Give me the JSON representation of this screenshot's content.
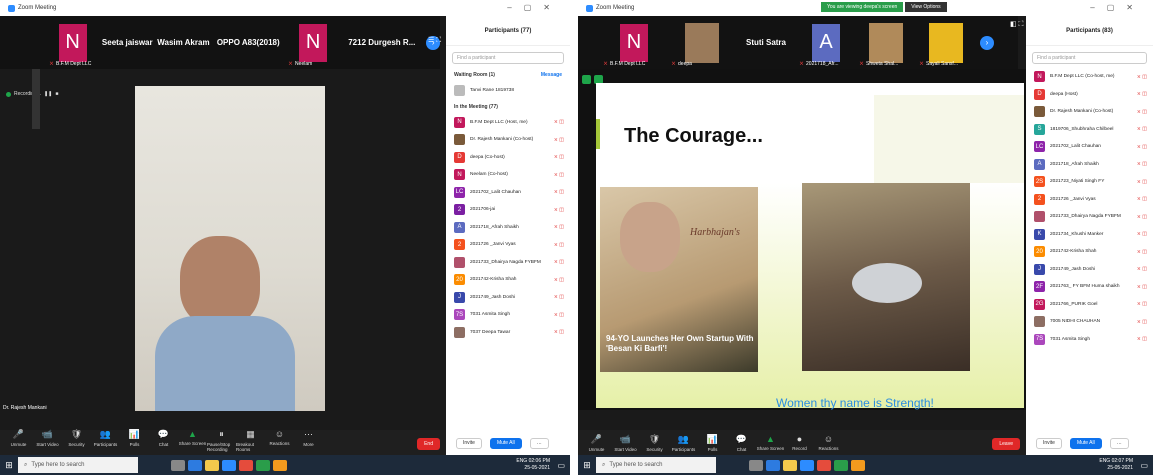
{
  "left": {
    "window_title": "Zoom Meeting",
    "strip": [
      {
        "type": "avatar",
        "letter": "N",
        "color": "#c2185b",
        "caption": "B.F.M Dept LLC"
      },
      {
        "type": "name",
        "name": "Seeta jaiswar"
      },
      {
        "type": "name",
        "name": "Wasim Akram"
      },
      {
        "type": "name",
        "name": "OPPO A83(2018)"
      },
      {
        "type": "avatar",
        "letter": "N",
        "color": "#c2185b",
        "caption": "Neelam"
      },
      {
        "type": "name",
        "name": "7212 Durgesh R..."
      }
    ],
    "recording_label": "Recording...",
    "video_caption": "Dr. Rajesh Mankani",
    "panel_title": "Participants (77)",
    "find_placeholder": "Find a participant",
    "waiting_label": "Waiting Room (1)",
    "message_label": "Message",
    "waiting_person": "Tanvi Rane 1819738",
    "in_meeting_label": "In the Meeting (77)",
    "participants": [
      {
        "name": "B.F.M Dept LLC (Host, me)",
        "letter": "N",
        "color": "#c2185b"
      },
      {
        "name": "Dr. Rajesh Mankani (Co-host)",
        "letter": "",
        "color": "#7a5a3a"
      },
      {
        "name": "deepa (Co-host)",
        "letter": "D",
        "color": "#e53935"
      },
      {
        "name": "Neelam (Co-host)",
        "letter": "N",
        "color": "#c2185b"
      },
      {
        "name": "2021702_Lalit Chauhan",
        "letter": "LC",
        "color": "#8e24aa"
      },
      {
        "name": "2021706-jai",
        "letter": "2",
        "color": "#7b1fa2"
      },
      {
        "name": "2021718_Afrah Shaikh",
        "letter": "A",
        "color": "#5c6bc0"
      },
      {
        "name": "2021726 _Janvi Vyas",
        "letter": "2",
        "color": "#f4511e"
      },
      {
        "name": "2021733_Dhairya Nagda FYBFM",
        "letter": "",
        "color": "#b0506b"
      },
      {
        "name": "2021742-Krisha Shah",
        "letter": "20",
        "color": "#fb8c00"
      },
      {
        "name": "2021749_Jash Doshi",
        "letter": "J",
        "color": "#3949ab"
      },
      {
        "name": "7031 Asmita Singh",
        "letter": "7S",
        "color": "#ab47bc"
      },
      {
        "name": "7037 Deepa Tawar",
        "letter": "",
        "color": "#8d6e63"
      }
    ],
    "invite_label": "Invite",
    "mute_all_label": "Mute All",
    "toolbar": [
      {
        "icon": "🎤",
        "label": "Unmute"
      },
      {
        "icon": "📹",
        "label": "Start Video"
      },
      {
        "icon": "🛡",
        "label": "Security"
      },
      {
        "icon": "👥",
        "label": "Participants"
      },
      {
        "icon": "📊",
        "label": "Polls"
      },
      {
        "icon": "💬",
        "label": "Chat"
      },
      {
        "icon": "▲",
        "label": "Share Screen",
        "green": true
      },
      {
        "icon": "⏸",
        "label": "Pause/Stop Recording"
      },
      {
        "icon": "▦",
        "label": "Breakout Rooms"
      },
      {
        "icon": "☺",
        "label": "Reactions"
      },
      {
        "icon": "⋯",
        "label": "More"
      }
    ],
    "end_label": "End",
    "search_placeholder": "Type here to search",
    "tray_time": "02:06 PM",
    "tray_date": "25-05-2021",
    "tray_lang": "ENG"
  },
  "right": {
    "window_title": "Zoom Meeting",
    "share_banner": "You are viewing deepa's screen",
    "view_options": "View Options",
    "strip": [
      {
        "type": "avatar",
        "letter": "N",
        "color": "#c2185b",
        "caption": "B.F.M Dept LLC"
      },
      {
        "type": "photo",
        "caption": "deepa",
        "color": "#9a7a5a"
      },
      {
        "type": "name",
        "name": "Stuti Satra"
      },
      {
        "type": "avatar",
        "letter": "A",
        "color": "#5c6bc0",
        "caption": "2021718_Afr..."
      },
      {
        "type": "photo",
        "caption": "Shweta Shal...",
        "color": "#b08a5a"
      },
      {
        "type": "photo",
        "caption": "Sayali Sansf...",
        "color": "#e8b820"
      }
    ],
    "slide_title": "The Courage...",
    "photo_text": "94-YO Launches Her Own Startup With 'Besan Ki Barfi'!",
    "brand_text": "Harbhajan's",
    "slide_caption": "Women thy name is Strength!",
    "panel_title": "Participants (83)",
    "find_placeholder": "Find a participant",
    "participants": [
      {
        "name": "B.F.M Dept LLC (Co-host, me)",
        "letter": "N",
        "color": "#c2185b"
      },
      {
        "name": "deepa (Host)",
        "letter": "D",
        "color": "#e53935"
      },
      {
        "name": "Dr. Rajesh Mankani (Co-host)",
        "letter": "",
        "color": "#7a5a3a"
      },
      {
        "name": "1819706_Shubhraha Chilbeel",
        "letter": "S",
        "color": "#26a69a"
      },
      {
        "name": "2021702_Lalit Chauhan",
        "letter": "LC",
        "color": "#8e24aa"
      },
      {
        "name": "2021718_Afrah Shaikh",
        "letter": "A",
        "color": "#5c6bc0"
      },
      {
        "name": "2021723_Niyati Singh FY",
        "letter": "2S",
        "color": "#f4511e"
      },
      {
        "name": "2021726 _Janvi Vyas",
        "letter": "2",
        "color": "#f4511e"
      },
      {
        "name": "2021733_Dhairya Nagda FYBFM",
        "letter": "",
        "color": "#b0506b"
      },
      {
        "name": "2021734_Khushi Manker",
        "letter": "K",
        "color": "#3949ab"
      },
      {
        "name": "2021742-Krisha Shah",
        "letter": "20",
        "color": "#fb8c00"
      },
      {
        "name": "2021749_Jash Doshi",
        "letter": "J",
        "color": "#3949ab"
      },
      {
        "name": "2021763_ FY BFM Huma shaikh",
        "letter": "2F",
        "color": "#8e24aa"
      },
      {
        "name": "2021766_PURIK Goel",
        "letter": "2G",
        "color": "#c2185b"
      },
      {
        "name": "7005 NIDHI CHAUHAN",
        "letter": "",
        "color": "#8d6e63"
      },
      {
        "name": "7031 Asmita Singh",
        "letter": "7S",
        "color": "#ab47bc"
      }
    ],
    "invite_label": "Invite",
    "mute_all_label": "Mute All",
    "toolbar": [
      {
        "icon": "🎤",
        "label": "Unmute"
      },
      {
        "icon": "📹",
        "label": "Start Video"
      },
      {
        "icon": "🛡",
        "label": "Security"
      },
      {
        "icon": "👥",
        "label": "Participants"
      },
      {
        "icon": "📊",
        "label": "Polls"
      },
      {
        "icon": "💬",
        "label": "Chat"
      },
      {
        "icon": "▲",
        "label": "Share Screen",
        "green": true
      },
      {
        "icon": "●",
        "label": "Record"
      },
      {
        "icon": "☺",
        "label": "Reactions"
      }
    ],
    "leave_label": "Leave",
    "search_placeholder": "Type here to search",
    "tray_time": "02:07 PM",
    "tray_date": "25-05-2021",
    "tray_lang": "ENG"
  }
}
